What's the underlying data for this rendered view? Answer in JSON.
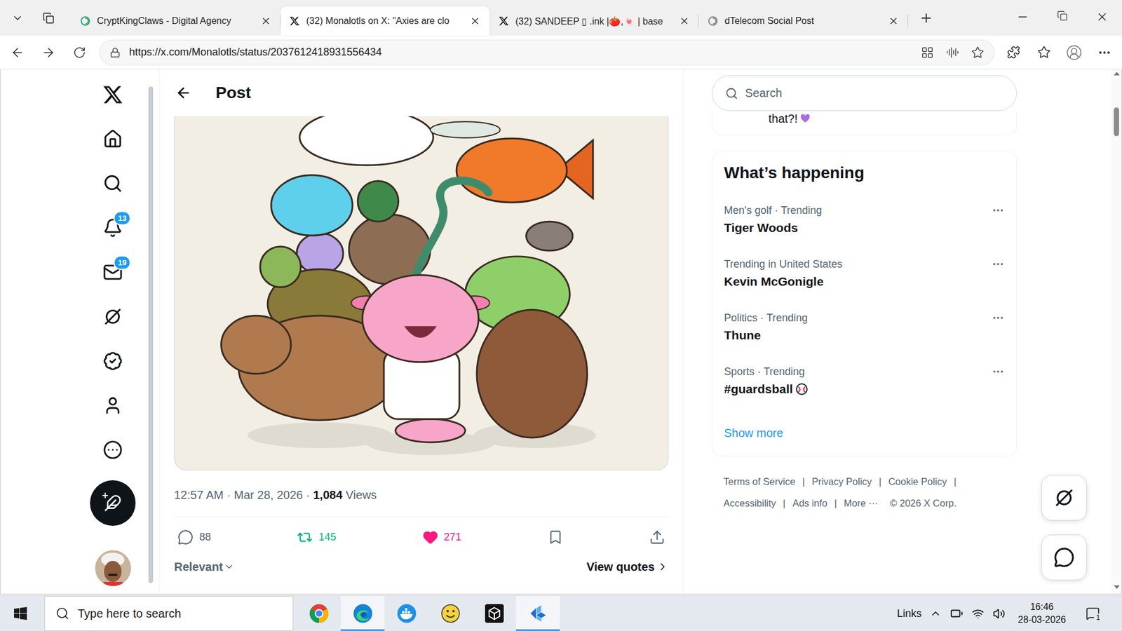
{
  "browser": {
    "tabs": [
      {
        "label": "CryptKingClaws - Digital Agency",
        "selected": false
      },
      {
        "label": "(32) Monalotls on X: \"Axies are clo",
        "selected": true
      },
      {
        "label": "(32) SANDEEP ▯ .ink |🍅,🍬 | base",
        "selected": false
      },
      {
        "label": "dTelecom Social Post",
        "selected": false
      }
    ],
    "url": "https://x.com/Monalotls/status/2037612418931556434"
  },
  "nav": {
    "items": [
      {
        "badge": null
      },
      {
        "badge": null
      },
      {
        "badge": null
      },
      {
        "badge": "13"
      },
      {
        "badge": "19"
      },
      {
        "badge": null
      },
      {
        "badge": null
      },
      {
        "badge": null
      },
      {
        "badge": null
      }
    ]
  },
  "post": {
    "header": "Post",
    "time": "12:57 AM",
    "date": "Mar 28, 2026",
    "separator": "·",
    "views": "1,084",
    "views_label": "Views",
    "actions": [
      {
        "kind": "reply",
        "count": "88",
        "active": false
      },
      {
        "kind": "repost",
        "count": "145",
        "active": true
      },
      {
        "kind": "like",
        "count": "271",
        "active": true
      },
      {
        "kind": "bookmark",
        "count": null,
        "active": false
      },
      {
        "kind": "share",
        "count": null,
        "active": false
      }
    ],
    "sort": "Relevant",
    "quotes": "View quotes"
  },
  "sidebar": {
    "search": {
      "placeholder": "Search"
    },
    "previous_card": {
      "text": "that?!"
    },
    "trends": {
      "title": "What’s happening",
      "items": [
        {
          "kind": "topic",
          "context": "Men's golf · Trending",
          "name": "Tiger Woods"
        },
        {
          "kind": "topic",
          "context": "Trending in United States",
          "name": "Kevin McGonigle"
        },
        {
          "kind": "topic",
          "context": "Politics · Trending",
          "name": "Thune"
        },
        {
          "kind": "event",
          "context": "Sports · Trending",
          "name": "#guardsball"
        }
      ],
      "show_more": "Show more"
    },
    "footer": {
      "separator": "|",
      "rows": [
        [
          {
            "label": "Terms of Service",
            "separated": true
          },
          {
            "label": "Privacy Policy",
            "separated": true
          },
          {
            "label": "Cookie Policy",
            "separated": true
          }
        ],
        [
          {
            "label": "Accessibility",
            "separated": true
          },
          {
            "label": "Ads info",
            "separated": true
          },
          {
            "label": "More ···",
            "separated": false
          },
          {
            "label": "© 2026 X Corp.",
            "separated": false
          }
        ]
      ]
    }
  },
  "taskbar": {
    "search_placeholder": "Type here to search",
    "apps": [
      {
        "kind": "chrome",
        "active": false
      },
      {
        "kind": "edge",
        "active": true
      },
      {
        "kind": "docker",
        "active": false
      },
      {
        "kind": "smiley",
        "active": false
      },
      {
        "kind": "cube",
        "active": false
      },
      {
        "kind": "kodi",
        "active": true
      }
    ],
    "links": "Links",
    "time": "16:46",
    "date": "28-03-2026",
    "notifications": "1"
  }
}
